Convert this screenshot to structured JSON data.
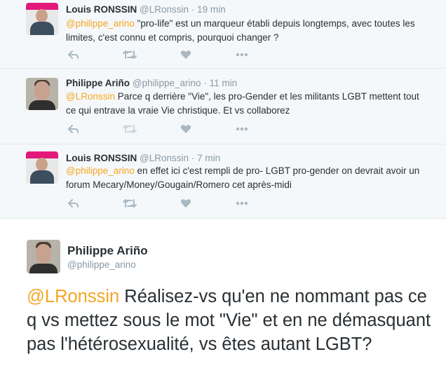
{
  "replies": [
    {
      "name": "Louis RONSSIN",
      "handle": "@LRonssin",
      "separator": "·",
      "time": "19 min",
      "mention": "@philippe_arino",
      "text": " \"pro-life\" est un marqueur établi depuis longtemps, avec toutes les limites, c'est connu et compris, pourquoi changer ?"
    },
    {
      "name": "Philippe Ariño",
      "handle": "@philippe_arino",
      "separator": "·",
      "time": "11 min",
      "mention": "@LRonssin",
      "text": " Parce q derrière \"Vie\", les pro-Gender et les militants LGBT mettent tout ce qui entrave la vraie Vie christique. Et vs collaborez"
    },
    {
      "name": "Louis RONSSIN",
      "handle": "@LRonssin",
      "separator": "·",
      "time": "7 min",
      "mention": "@philippe_arino",
      "text": " en effet ici c'est rempli de pro- LGBT pro-gender on devrait avoir un forum Mecary/Money/Gougain/Romero cet après-midi"
    }
  ],
  "main_tweet": {
    "name": "Philippe Ariño",
    "handle": "@philippe_arino",
    "mention": "@LRonssin",
    "text": " Réalisez-vs qu'en ne nommant pas ce q vs mettez sous le mot \"Vie\" et en ne démasquant pas l'hétérosexualité, vs êtes autant LGBT?"
  },
  "icons": [
    "reply-icon",
    "retweet-icon",
    "like-icon",
    "more-icon"
  ],
  "colors": {
    "mention": "#f5a623",
    "muted": "#8899a6",
    "reply_bg": "#f5f8fa"
  }
}
